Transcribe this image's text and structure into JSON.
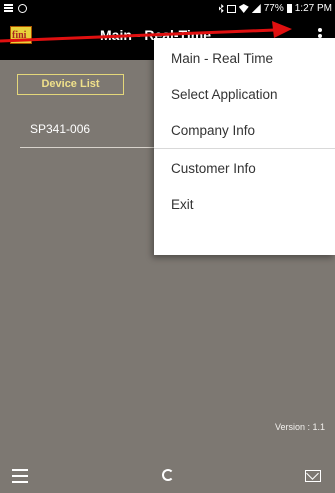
{
  "status_bar": {
    "battery": "77%",
    "time": "1:27 PM"
  },
  "action_bar": {
    "logo_text": "fini",
    "title": "Main - Real-Time"
  },
  "tabs": [
    {
      "label": "Device List"
    }
  ],
  "devices": [
    {
      "name": "SP341-006"
    }
  ],
  "menu": {
    "items": [
      {
        "label": "Main - Real Time"
      },
      {
        "label": "Select Application"
      },
      {
        "label": "Company Info"
      },
      {
        "label": "Customer Info"
      },
      {
        "label": "Exit"
      }
    ]
  },
  "footer": {
    "version": "Version : 1.1"
  },
  "icons": {
    "status_left": [
      "menu-icon",
      "sync-icon"
    ],
    "status_right": [
      "bluetooth-icon",
      "vibrate-icon",
      "wifi-icon",
      "signal-icon",
      "battery-icon"
    ],
    "bottom_nav": [
      "list-icon",
      "refresh-icon",
      "mail-icon"
    ],
    "overflow": "overflow-menu-icon"
  },
  "colors": {
    "background": "#7d7872",
    "bar": "#000000",
    "accent": "#efe08a",
    "annotation_arrow": "#e01010"
  }
}
